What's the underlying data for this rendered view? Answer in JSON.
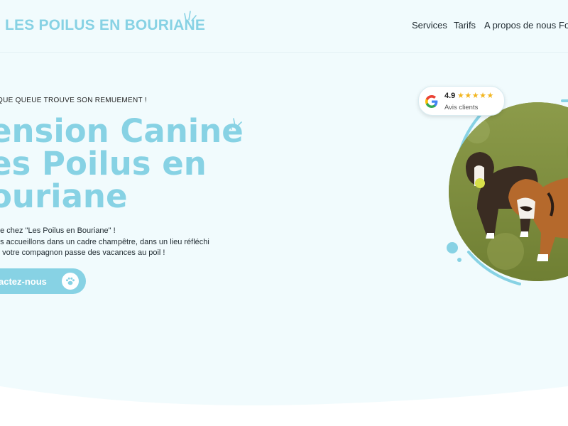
{
  "colors": {
    "brand": "#87d2e4",
    "background": "#f1fbfd",
    "text": "#1f2a30",
    "stars": "#f2b51f"
  },
  "header": {
    "logo_text": "LES POILUS EN BOURIANE",
    "nav": [
      {
        "label": "Services"
      },
      {
        "label": "Tarifs"
      },
      {
        "label": "A propos de nous"
      },
      {
        "label": "Fo"
      }
    ]
  },
  "hero": {
    "kicker": "QUE QUEUE TROUVE SON REMUEMENT !",
    "title_lines": [
      "ension Canine",
      "es Poilus en",
      "ouriane"
    ],
    "description_lines": [
      "ue chez \"Les Poilus en Bouriane\" !",
      "us accueillons dans un cadre champêtre, dans un lieu réfléchi",
      "e votre compagnon passe des vacances au poil !"
    ],
    "cta_label": "actez-nous",
    "cta_icon": "paw-icon"
  },
  "review_badge": {
    "icon": "google-icon",
    "rating": "4.9",
    "stars": "★★★★★",
    "label": "Avis clients"
  },
  "photo": {
    "icon": "dogs-photo"
  }
}
